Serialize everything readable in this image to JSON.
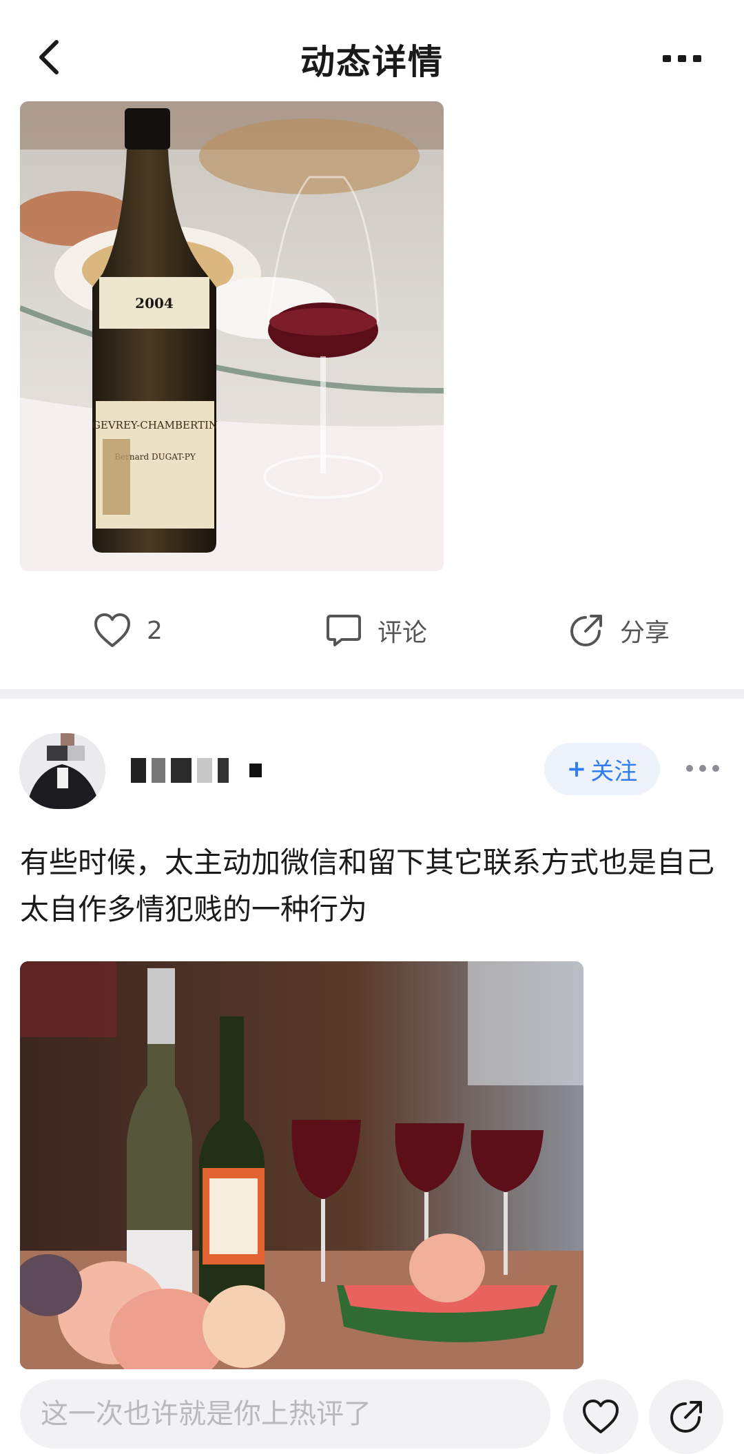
{
  "header": {
    "title": "动态详情"
  },
  "post1": {
    "actions": {
      "like_count": "2",
      "comment_label": "评论",
      "share_label": "分享"
    }
  },
  "post2": {
    "follow_label": "关注",
    "text": "有些时候，太主动加微信和留下其它联系方式也是自己太自作多情犯贱的一种行为"
  },
  "bottom_bar": {
    "comment_placeholder": "这一次也许就是你上热评了"
  },
  "icons": {
    "back": "chevron-left-icon",
    "more": "more-dots-icon",
    "like": "heart-outline-icon",
    "comment": "speech-bubble-icon",
    "share": "share-arrow-icon",
    "follow_plus": "plus-icon"
  },
  "colors": {
    "accent": "#2f7cf6",
    "divider": "#efeff1",
    "muted_text": "#555555"
  }
}
